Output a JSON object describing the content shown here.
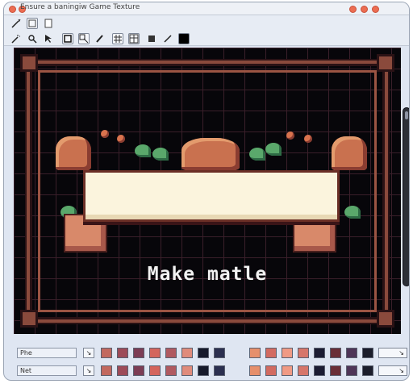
{
  "window": {
    "title": "Ensure a baningiw Game Texture"
  },
  "toolbar": {
    "tools": [
      "magic-wand",
      "zoom",
      "select",
      "square",
      "transform",
      "brush",
      "grid",
      "grid2",
      "layers",
      "line",
      "color"
    ]
  },
  "canvas": {
    "caption": "Make matle"
  },
  "bottom": {
    "row1_label": "Phe",
    "row2_label": "Net",
    "swatches_left": [
      "#c2695f",
      "#9d4b58",
      "#7c3d55",
      "#d4655d",
      "#b05a61",
      "#e08b7b",
      "#161a2b",
      "#2c3050"
    ],
    "swatches_right": [
      "#e68f6b",
      "#d26b61",
      "#f09a84",
      "#d6766a",
      "#1c1d33",
      "#6a2f37",
      "#4e3557",
      "#1b1d2b"
    ],
    "colors": {
      "accent": "#ec6d52"
    }
  }
}
